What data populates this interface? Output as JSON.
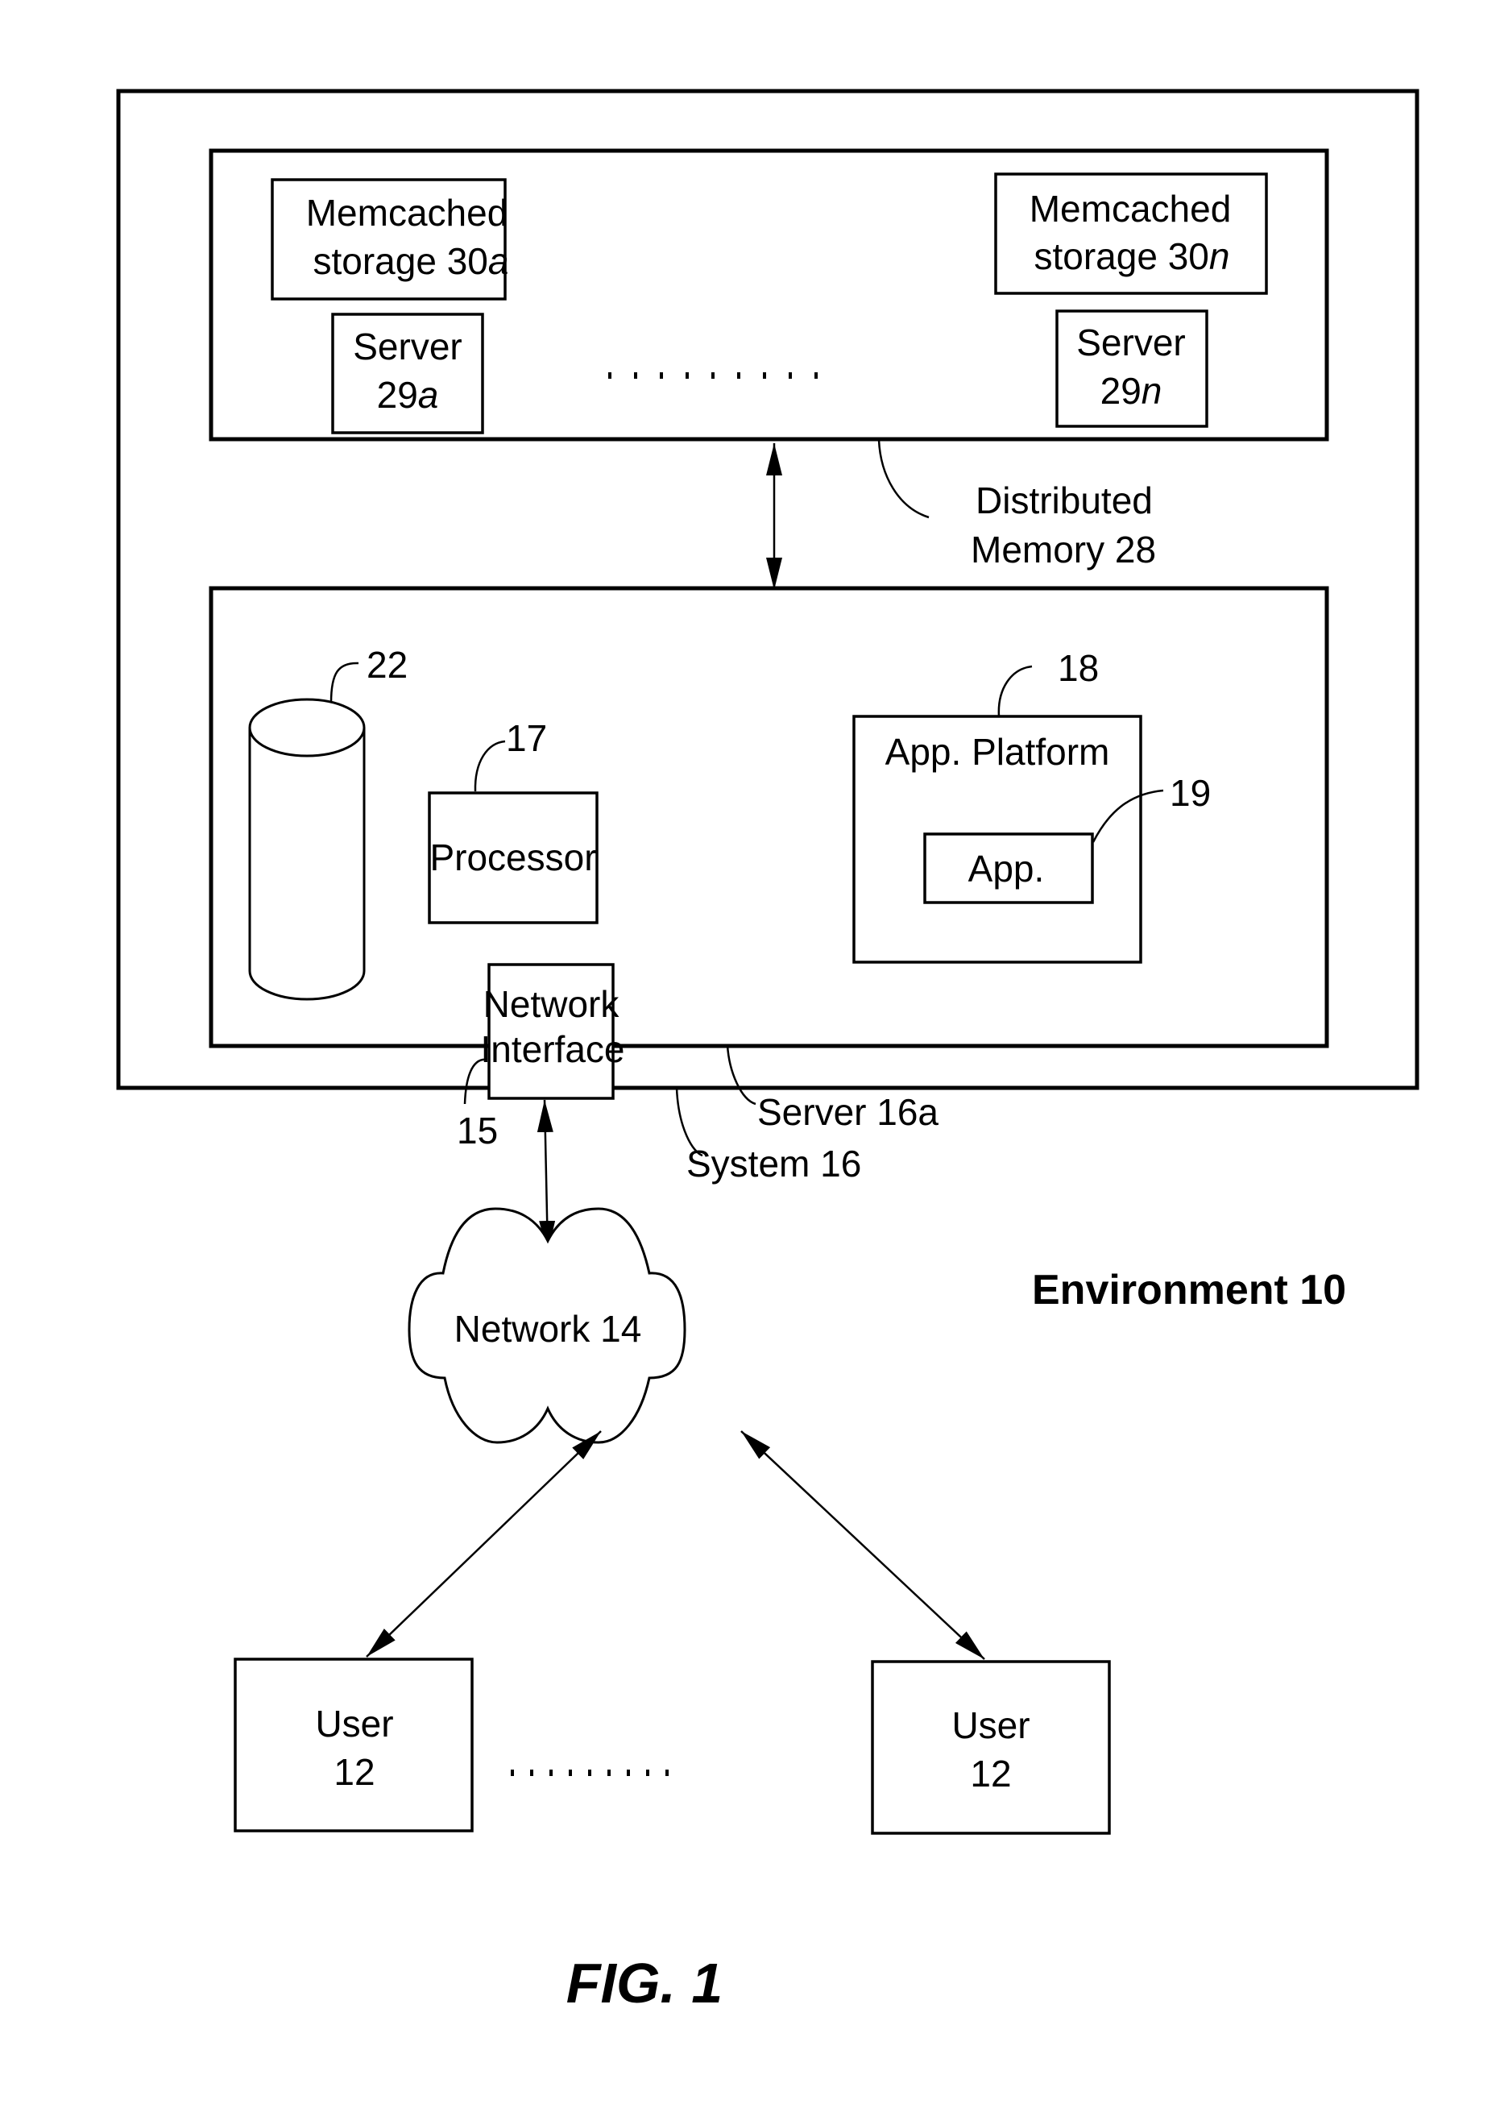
{
  "figure": {
    "caption": "FIG. 1",
    "environment_label": "Environment 10",
    "colors": {
      "ink": "#000000",
      "paper": "#ffffff"
    }
  },
  "system": {
    "label": "System 16",
    "distributed_memory": {
      "label_line1": "Distributed",
      "label_line2": "Memory 28",
      "storage_a": {
        "line1": "Memcached",
        "line2_prefix": "storage 30",
        "line2_suffix": "a"
      },
      "storage_n": {
        "line1": "Memcached",
        "line2_prefix": "storage 30",
        "line2_suffix": "n"
      },
      "server_a": {
        "line1": "Server",
        "line2_prefix": "29",
        "line2_suffix": "a"
      },
      "server_n": {
        "line1": "Server",
        "line2_prefix": "29",
        "line2_suffix": "n"
      }
    },
    "server": {
      "label": "Server 16a",
      "database_ref": "22",
      "processor": {
        "label": "Processor",
        "ref": "17"
      },
      "app_platform": {
        "label": "App. Platform",
        "ref": "18"
      },
      "app": {
        "label": "App.",
        "ref": "19"
      },
      "network_interface": {
        "line1": "Network",
        "line2": "Interface",
        "ref": "15"
      }
    }
  },
  "network": {
    "label": "Network 14"
  },
  "users": [
    {
      "line1": "User",
      "line2": "12"
    },
    {
      "line1": "User",
      "line2": "12"
    }
  ]
}
